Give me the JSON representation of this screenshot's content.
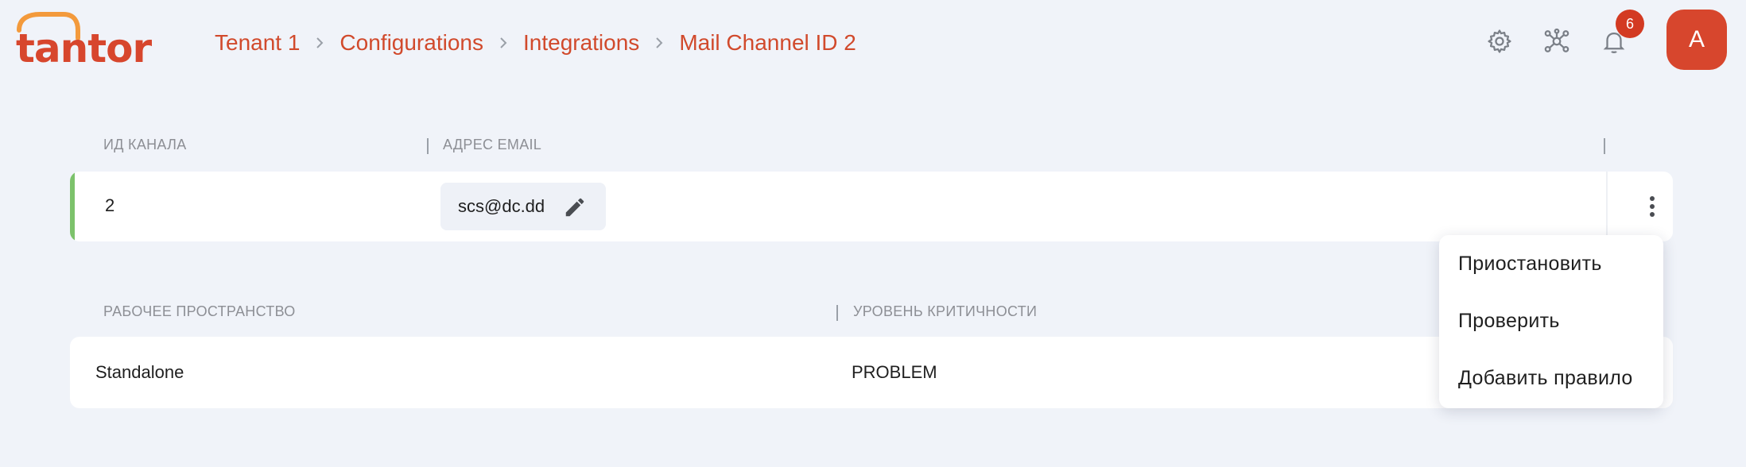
{
  "logo": {
    "text": "tantor"
  },
  "breadcrumb": [
    {
      "label": "Tenant 1"
    },
    {
      "label": "Configurations"
    },
    {
      "label": "Integrations"
    },
    {
      "label": "Mail Channel ID 2"
    }
  ],
  "header": {
    "notifications_count": "6",
    "avatar_initial": "A",
    "icons": [
      "gear-icon",
      "network-icon",
      "bell-icon"
    ]
  },
  "channel_table": {
    "columns": [
      "ИД КАНАЛА",
      "АДРЕС EMAIL"
    ],
    "row": {
      "channel_id": "2",
      "email": "scs@dc.dd",
      "status_color": "#7cc26b"
    }
  },
  "workspace_table": {
    "columns": [
      "РАБОЧЕЕ ПРОСТРАНСТВО",
      "УРОВЕНЬ КРИТИЧНОСТИ"
    ],
    "row": {
      "workspace": "Standalone",
      "severity": "PROBLEM"
    }
  },
  "context_menu": {
    "items": [
      "Приостановить",
      "Проверить",
      "Добавить правило"
    ]
  },
  "colors": {
    "accent": "#d14a2c",
    "background": "#f0f3f9",
    "badge": "#d33a22"
  }
}
